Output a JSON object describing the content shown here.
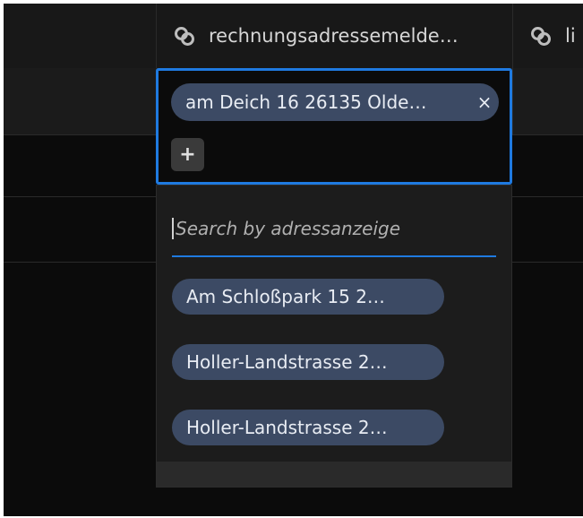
{
  "columns": [
    {
      "label": "rechnungsadressemelde…",
      "icon": "link-icon"
    },
    {
      "label": "li",
      "icon": "link-icon"
    }
  ],
  "editor": {
    "chip_label": "am Deich 16 26135 Olde…",
    "remove_label": "×",
    "add_label": "+"
  },
  "dropdown": {
    "search_placeholder": "Search by adressanzeige",
    "search_value": "",
    "options": [
      {
        "label": "Am Schloßpark 15 2…"
      },
      {
        "label": "Holler-Landstrasse 2…"
      },
      {
        "label": "Holler-Landstrasse 2…"
      }
    ]
  },
  "colors": {
    "accent": "#1f7ae0",
    "chip": "#3c4a64",
    "background": "#0b0b0b",
    "panel": "#1c1c1c"
  }
}
